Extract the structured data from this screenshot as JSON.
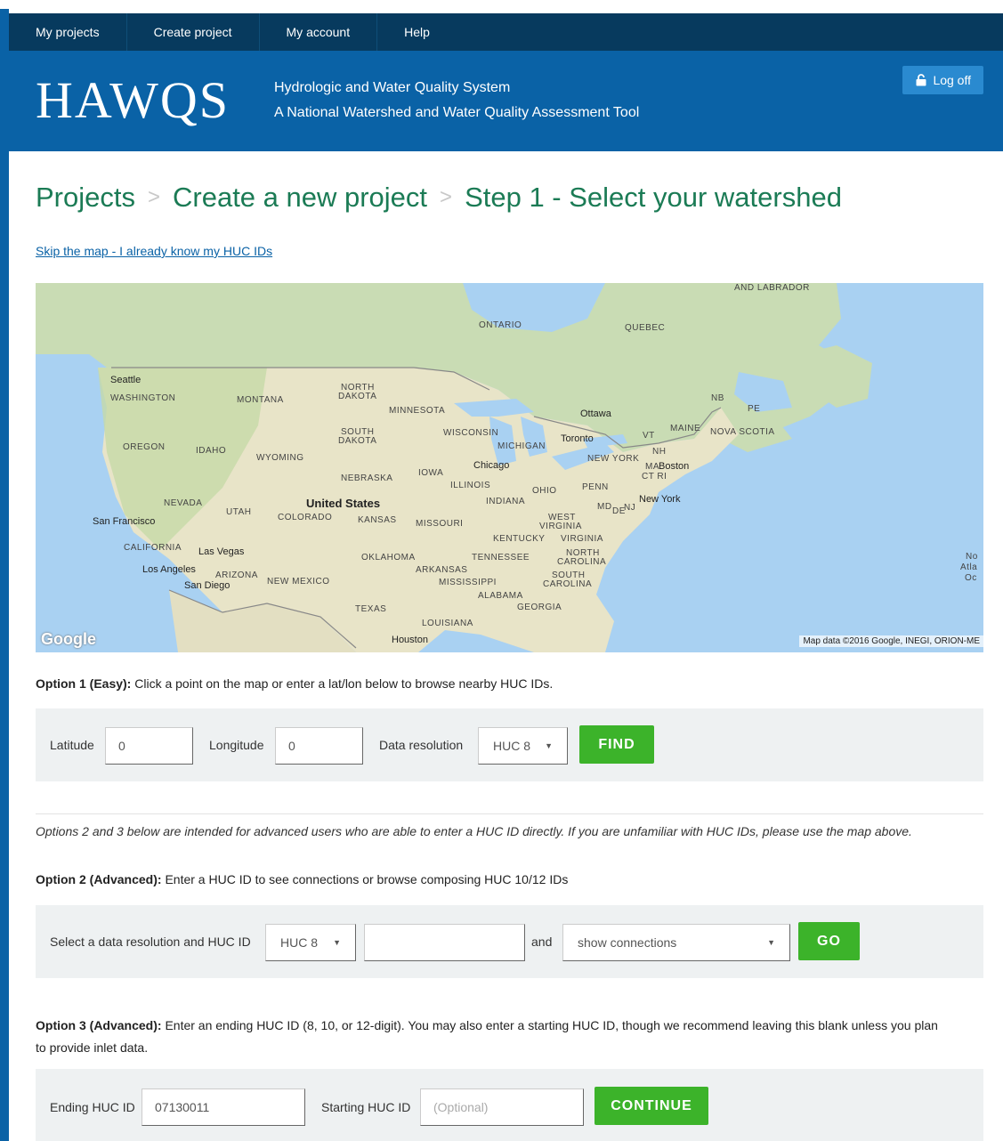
{
  "nav": {
    "items": [
      "My projects",
      "Create project",
      "My account",
      "Help"
    ]
  },
  "header": {
    "logo": "HAWQS",
    "tagline_line1": "Hydrologic and Water Quality System",
    "tagline_line2": "A National Watershed and Water Quality Assessment Tool",
    "logoff_label": "Log off"
  },
  "breadcrumb": {
    "items": [
      "Projects",
      "Create a new project",
      "Step 1 - Select your watershed"
    ],
    "separator": ">"
  },
  "skip_link": "Skip the map - I already know my HUC IDs",
  "map": {
    "labels": {
      "ontario": "ONTARIO",
      "quebec": "QUEBEC",
      "labrador": "AND LABRADOR",
      "washington": "WASHINGTON",
      "montana": "MONTANA",
      "north_dakota_1": "NORTH",
      "north_dakota_2": "DAKOTA",
      "minnesota": "MINNESOTA",
      "south_dakota_1": "SOUTH",
      "south_dakota_2": "DAKOTA",
      "wisconsin": "WISCONSIN",
      "michigan": "MICHIGAN",
      "oregon": "OREGON",
      "idaho": "IDAHO",
      "wyoming": "WYOMING",
      "iowa": "IOWA",
      "nebraska": "NEBRASKA",
      "illinois": "ILLINOIS",
      "ohio": "OHIO",
      "penn": "PENN",
      "indiana": "INDIANA",
      "nevada": "NEVADA",
      "utah": "UTAH",
      "colorado": "COLORADO",
      "kansas": "KANSAS",
      "missouri": "MISSOURI",
      "west_virginia_1": "WEST",
      "west_virginia_2": "VIRGINIA",
      "kentucky": "KENTUCKY",
      "virginia": "VIRGINIA",
      "california": "CALIFORNIA",
      "oklahoma": "OKLAHOMA",
      "tennessee": "TENNESSEE",
      "north_carolina_1": "NORTH",
      "north_carolina_2": "CAROLINA",
      "arizona": "ARIZONA",
      "arkansas": "ARKANSAS",
      "new_mexico": "NEW MEXICO",
      "mississippi": "MISSISSIPPI",
      "south_carolina_1": "SOUTH",
      "south_carolina_2": "CAROLINA",
      "alabama": "ALABAMA",
      "georgia": "GEORGIA",
      "texas": "TEXAS",
      "louisiana": "LOUISIANA",
      "new_york": "NEW YORK",
      "vt": "VT",
      "nh": "NH",
      "maine": "MAINE",
      "nb": "NB",
      "pe": "PE",
      "nova_scotia": "NOVA SCOTIA",
      "ma": "MA",
      "ct_ri": "CT RI",
      "md": "MD",
      "de": "DE",
      "nj": "NJ",
      "atl_1": "No",
      "atl_2": "Atla",
      "atl_3": "Oc"
    },
    "cities": {
      "seattle": "Seattle",
      "ottawa": "Ottawa",
      "toronto": "Toronto",
      "chicago": "Chicago",
      "boston": "Boston",
      "new_york": "New York",
      "san_francisco": "San Francisco",
      "las_vegas": "Las Vegas",
      "los_angeles": "Los Angeles",
      "san_diego": "San Diego",
      "houston": "Houston"
    },
    "country": "United States",
    "google": "Google",
    "attribution": "Map data ©2016 Google, INEGI, ORION-ME"
  },
  "option1": {
    "title": "Option 1 (Easy):",
    "text": " Click a point on the map or enter a lat/lon below to browse nearby HUC IDs.",
    "latitude_label": "Latitude",
    "latitude_value": "0",
    "longitude_label": "Longitude",
    "longitude_value": "0",
    "resolution_label": "Data resolution",
    "resolution_value": "HUC 8",
    "find_label": "FIND"
  },
  "advanced_note": "Options 2 and 3 below are intended for advanced users who are able to enter a HUC ID directly. If you are unfamiliar with HUC IDs, please use the map above.",
  "option2": {
    "title": "Option 2 (Advanced):",
    "text": " Enter a HUC ID to see connections or browse composing HUC 10/12 IDs",
    "select_label": "Select a data resolution and HUC ID",
    "resolution_value": "HUC 8",
    "huc_value": "",
    "and_label": "and",
    "action_value": "show connections",
    "go_label": "GO"
  },
  "option3": {
    "title": "Option 3 (Advanced):",
    "text_line1": " Enter an ending HUC ID (8, 10, or 12-digit). You may also enter a starting HUC ID, though we recommend leaving this blank unless you plan",
    "text_line2": "to provide inlet data.",
    "ending_label": "Ending HUC ID",
    "ending_value": "07130011",
    "starting_label": "Starting HUC ID",
    "starting_placeholder": "(Optional)",
    "continue_label": "CONTINUE"
  },
  "colors": {
    "nav_bg": "#073a5e",
    "banner_bg": "#0a62a6",
    "heading_green": "#1b7b55",
    "button_green": "#3cb32a",
    "panel_bg": "#eef1f2"
  }
}
